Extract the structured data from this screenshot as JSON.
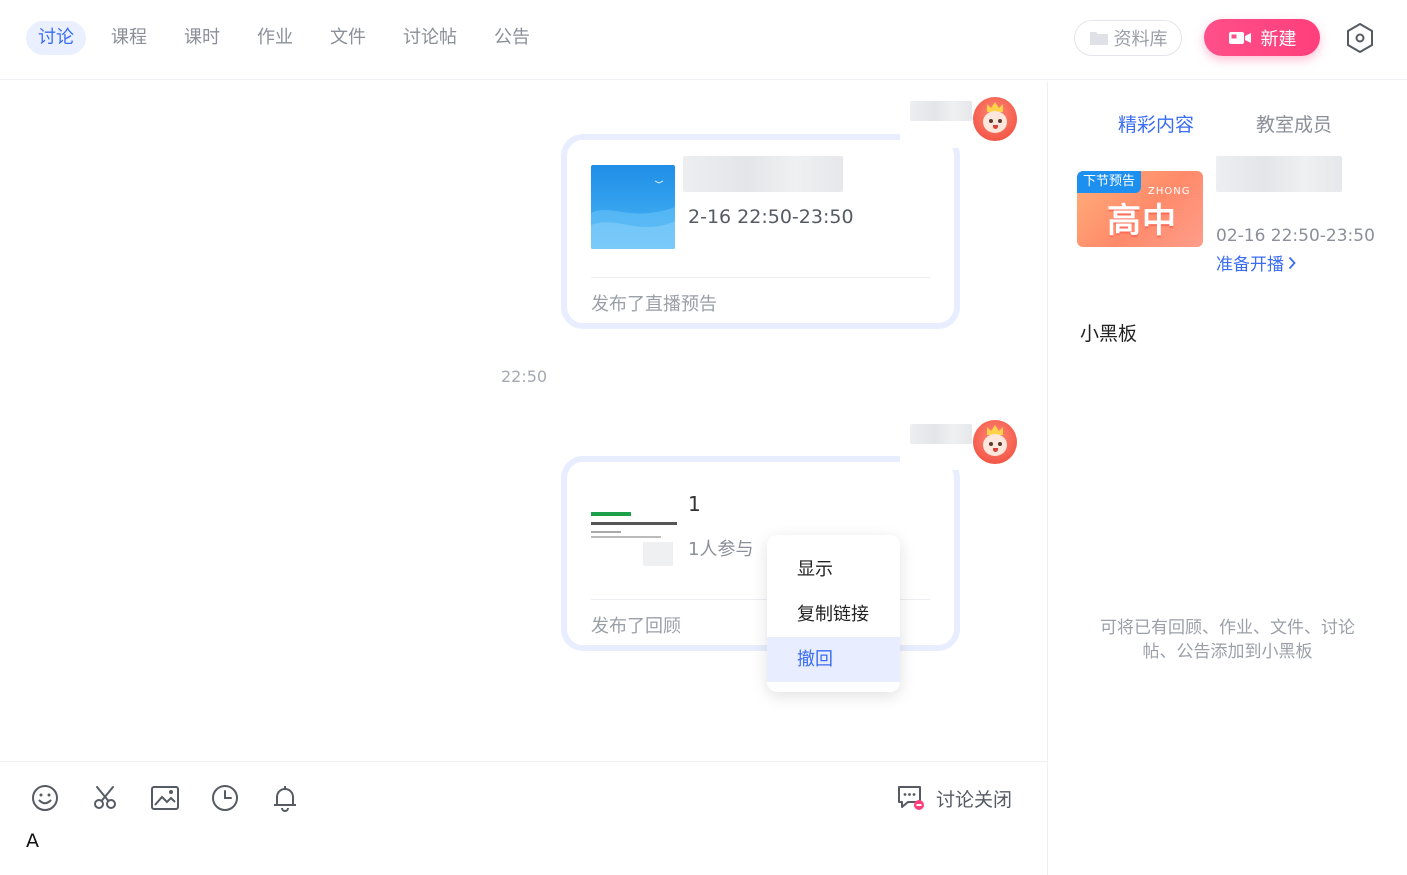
{
  "tabs": [
    {
      "label": "讨论",
      "active": true
    },
    {
      "label": "课程",
      "active": false
    },
    {
      "label": "课时",
      "active": false
    },
    {
      "label": "作业",
      "active": false
    },
    {
      "label": "文件",
      "active": false
    },
    {
      "label": "讨论帖",
      "active": false
    },
    {
      "label": "公告",
      "active": false
    }
  ],
  "header": {
    "library_label": "资料库",
    "new_label": "新建"
  },
  "messages": [
    {
      "meta": "2-16  22:50-23:50",
      "footer": "发布了直播预告"
    },
    {
      "title": "1",
      "meta": "1人参与",
      "footer": "发布了回顾"
    }
  ],
  "time_label": "22:50",
  "context_menu": {
    "items": [
      "显示",
      "复制链接",
      "撤回"
    ],
    "selected": "撤回"
  },
  "composer": {
    "close_label": "讨论关闭",
    "input_text": "A"
  },
  "right_panel": {
    "tabs": [
      {
        "label": "精彩内容",
        "active": true
      },
      {
        "label": "教室成员",
        "active": false
      }
    ],
    "next_live": {
      "badge": "下节预告",
      "thumb_text": "高中",
      "thumb_small": "ZHONG",
      "time": "02-16 22:50-23:50",
      "action": "准备开播"
    },
    "blackboard_title": "小黑板",
    "blackboard_hint": "可将已有回顾、作业、文件、讨论帖、公告添加到小黑板"
  },
  "colors": {
    "accent": "#3a6cf4",
    "pink": "#ff4f8a",
    "card_border": "#e8eeff"
  }
}
